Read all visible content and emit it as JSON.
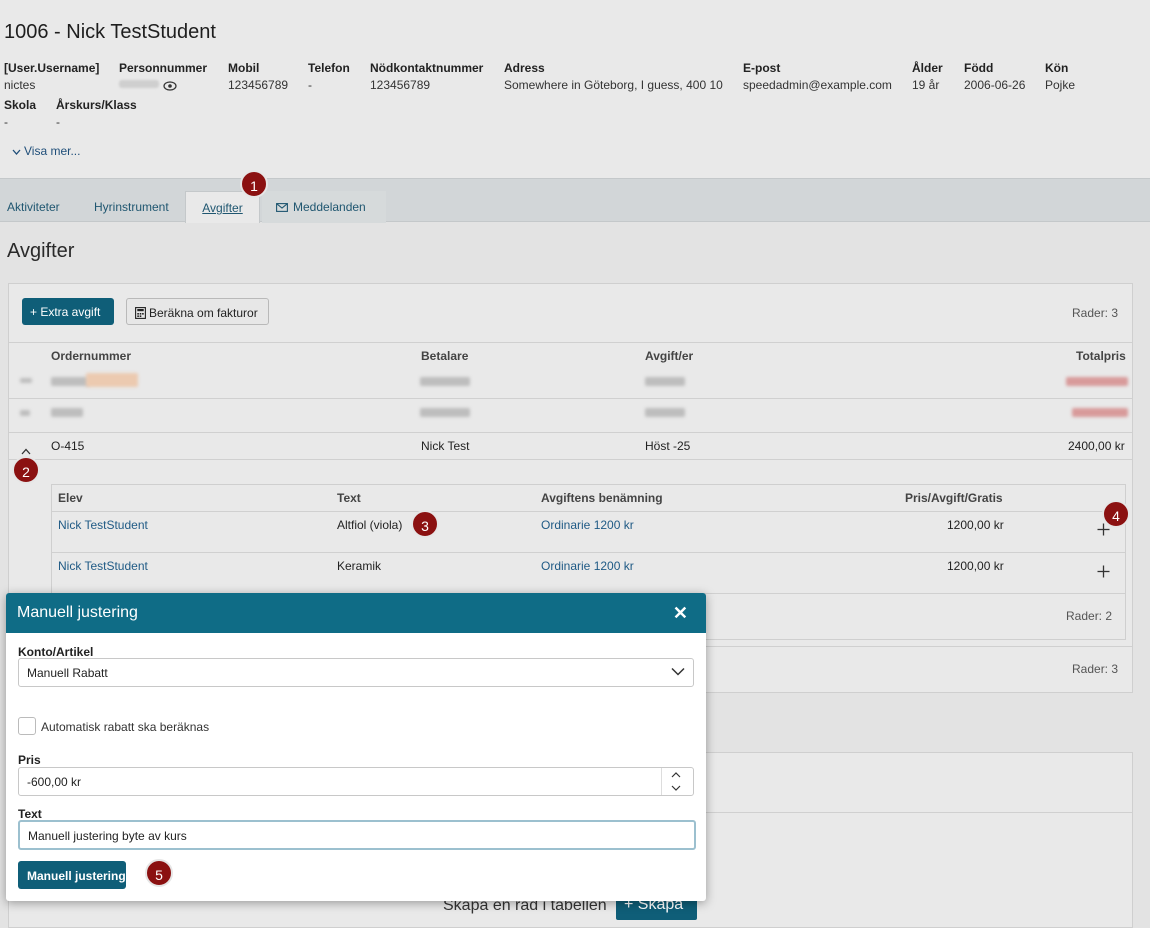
{
  "header": {
    "title": "1006 - Nick TestStudent",
    "fields": [
      {
        "label": "[User.Username]",
        "value": "nictes"
      },
      {
        "label": "Personnummer",
        "value": ""
      },
      {
        "label": "Mobil",
        "value": "123456789"
      },
      {
        "label": "Telefon",
        "value": "-"
      },
      {
        "label": "Nödkontaktnummer",
        "value": "123456789"
      },
      {
        "label": "Adress",
        "value": "Somewhere in Göteborg, I guess, 400 10"
      },
      {
        "label": "E-post",
        "value": "speedadmin@example.com"
      },
      {
        "label": "Ålder",
        "value": "19 år"
      },
      {
        "label": "Född",
        "value": "2006-06-26"
      },
      {
        "label": "Kön",
        "value": "Pojke"
      },
      {
        "label": "Skola",
        "value": "-"
      },
      {
        "label": "Årskurs/Klass",
        "value": "-"
      }
    ],
    "show_more": "Visa mer..."
  },
  "tabs": [
    {
      "label": "Aktiviteter"
    },
    {
      "label": "Hyrinstrument"
    },
    {
      "label": "Avgifter",
      "active": true
    },
    {
      "label": "Meddelanden",
      "icon": "envelope-icon"
    }
  ],
  "badges": [
    "1",
    "2",
    "3",
    "4",
    "5"
  ],
  "fees": {
    "title": "Avgifter",
    "extra_fee_button": "+ Extra avgift",
    "recalc_button": "Beräkna om fakturor",
    "rows_count": "Rader: 3",
    "columns": [
      "Ordernummer",
      "Betalare",
      "Avgift/er",
      "Totalpris"
    ],
    "expanded_row": {
      "order": "O-415",
      "payer": "Nick Test",
      "fee": "Höst -25",
      "total": "2400,00 kr"
    },
    "sub_columns": [
      "Elev",
      "Text",
      "Avgiftens benämning",
      "Pris/Avgift/Gratis"
    ],
    "sub_rows": [
      {
        "student": "Nick TestStudent",
        "text": "Altfiol (viola)",
        "fee_name": "Ordinarie 1200 kr",
        "price": "1200,00 kr"
      },
      {
        "student": "Nick TestStudent",
        "text": "Keramik",
        "fee_name": "Ordinarie 1200 kr",
        "price": "1200,00 kr"
      }
    ],
    "sub_rows_count": "Rader: 2",
    "outer_rows_count": "Rader: 3"
  },
  "lower": {
    "create_text": "Skapa en rad i tabellen",
    "create_button": "+ Skapa"
  },
  "modal": {
    "title": "Manuell justering",
    "account_label": "Konto/Artikel",
    "account_value": "Manuell Rabatt",
    "auto_discount_label": "Automatisk rabatt ska beräknas",
    "price_label": "Pris",
    "price_value": "-600,00 kr",
    "text_label": "Text",
    "text_value": "Manuell justering byte av kurs",
    "submit_label": "Manuell justering"
  },
  "colors": {
    "primary": "#0f5e78",
    "modal_header": "#0f6c86",
    "badge": "#8b1111"
  }
}
